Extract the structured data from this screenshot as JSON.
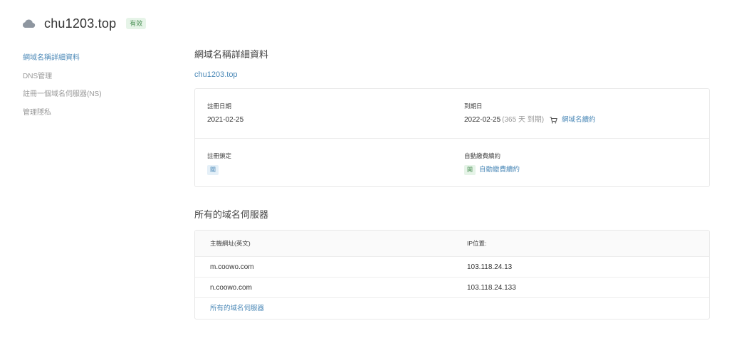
{
  "header": {
    "domain": "chu1203.top",
    "status": "有效",
    "icon": "cloud-icon"
  },
  "sidebar": {
    "items": [
      {
        "label": "網域名稱詳細資料",
        "active": true
      },
      {
        "label": "DNS管理",
        "active": false
      },
      {
        "label": "註冊一個域名伺服器(NS)",
        "active": false
      },
      {
        "label": "管理隱私",
        "active": false
      }
    ]
  },
  "details": {
    "title": "網域名稱詳細資料",
    "domain_link": "chu1203.top",
    "registration_date_label": "註冊日期",
    "registration_date": "2021-02-25",
    "expiry_label": "到期日",
    "expiry_date": "2022-02-25",
    "expiry_remaining": "(365 天 到期)",
    "renew_link": "網域名續約",
    "lock_label": "註冊鎖定",
    "lock_value": "關",
    "auto_renew_label": "自動繳費續約",
    "auto_renew_state": "開",
    "auto_renew_link": "自動繳費續約"
  },
  "nameservers": {
    "title": "所有的域名伺服器",
    "col_host": "主機網址(英文)",
    "col_ip": "IP位置:",
    "rows": [
      {
        "host": "m.coowo.com",
        "ip": "103.118.24.13"
      },
      {
        "host": "n.coowo.com",
        "ip": "103.118.24.133"
      }
    ],
    "footer_link": "所有的域名伺服器"
  },
  "colors": {
    "accent": "#4d8ab8",
    "success": "#4a8f54",
    "muted": "#999999"
  }
}
